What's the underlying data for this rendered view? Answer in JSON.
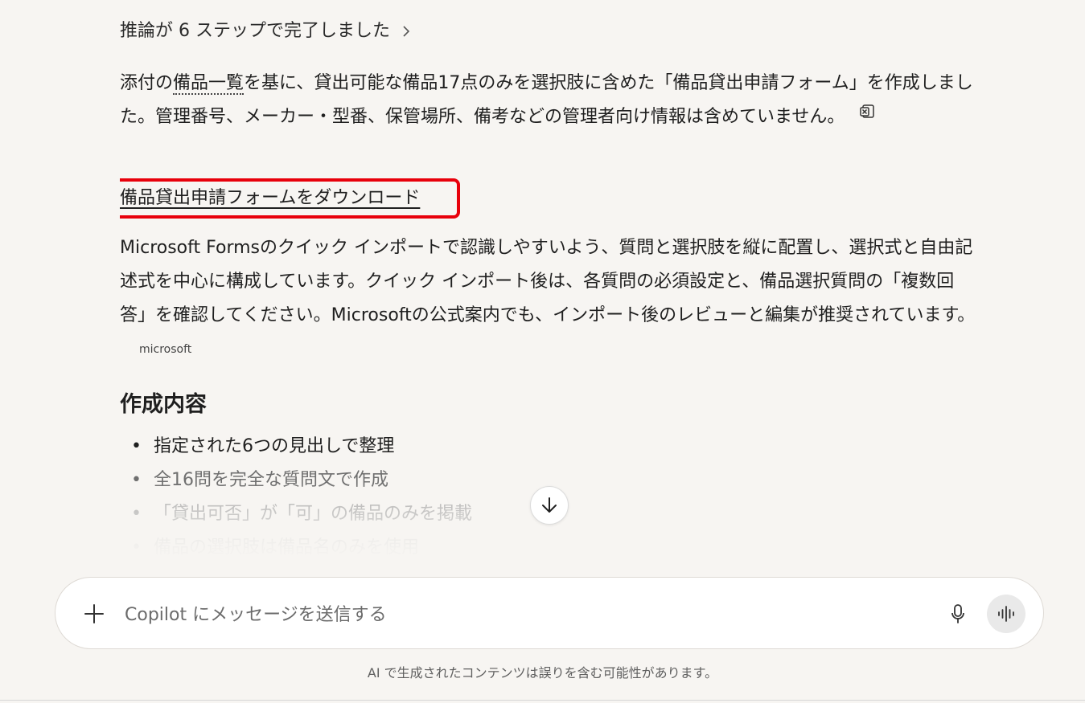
{
  "reasoning": {
    "label": "推論が 6 ステップで完了しました"
  },
  "message": {
    "para1_prefix": "添付の",
    "para1_link": "備品一覧",
    "para1_rest": "を基に、貸出可能な備品17点のみを選択肢に含めた「備品貸出申請フォーム」を作成しました。管理番号、メーカー・型番、保管場所、備考などの管理者向け情報は含めていません。",
    "download_link": "備品貸出申請フォームをダウンロード",
    "para2": "Microsoft Formsのクイック インポートで認識しやすいよう、質問と選択肢を縦に配置し、選択式と自由記述式を中心に構成しています。クイック インポート後は、各質問の必須設定と、備品選択質問の「複数回答」を確認してください。Microsoftの公式案内でも、インポート後のレビューと編集が推奨されています。",
    "source_label": "microsoft",
    "section_title": "作成内容",
    "bullets": [
      "指定された6つの見出しで整理",
      "全16問を完全な質問文で作成",
      "「貸出可否」が「可」の備品のみを掲載",
      "備品の選択肢は備品名のみを使用"
    ]
  },
  "composer": {
    "placeholder": "Copilot にメッセージを送信する"
  },
  "footer": {
    "disclaimer": "AI で生成されたコンテンツは誤りを含む可能性があります。"
  },
  "icons": {
    "plus": "plus-icon",
    "mic": "microphone-icon",
    "voice": "voice-wave-icon",
    "scroll": "arrow-down-icon",
    "chevron": "chevron-right-icon",
    "excel": "excel-file-icon"
  },
  "colors": {
    "highlight_border": "#e8000b",
    "background": "#f7f5f2"
  }
}
